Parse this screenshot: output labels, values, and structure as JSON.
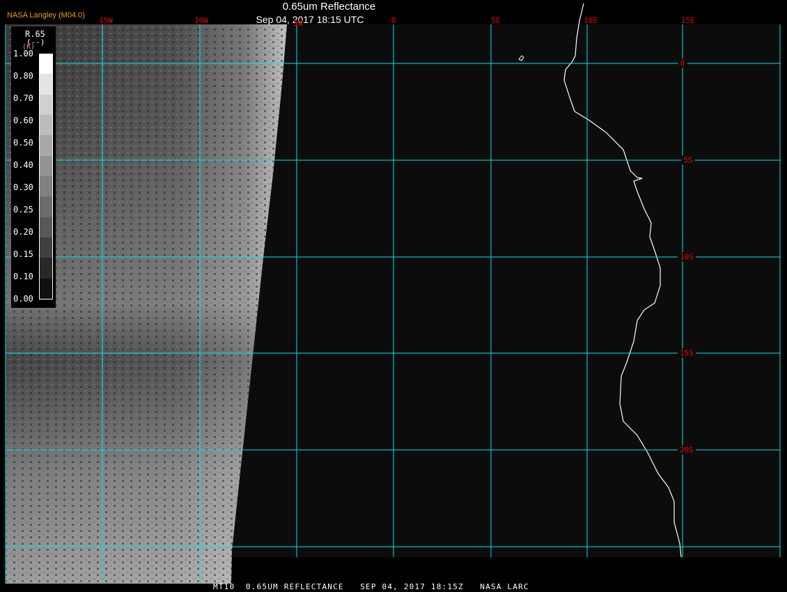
{
  "header": {
    "title": "0.65um Reflectance",
    "subtitle": "Sep 04, 2017 18:15 UTC",
    "brand": "NASA Langley (M04.0)"
  },
  "footer": {
    "text": "MT10  0.65UM REFLECTANCE   SEP 04, 2017 18:15Z   NASA LARC"
  },
  "grid": {
    "lon_labels": [
      "15W",
      "10W",
      "5W",
      "0",
      "5E",
      "10E",
      "15E"
    ],
    "lat_labels": [
      "0",
      "5S",
      "10S",
      "15S",
      "20S"
    ],
    "line_color": "#00e5ee",
    "label_color": "#e00000"
  },
  "legend": {
    "variable": "R.65",
    "units": "(--)",
    "unit_k": "(K)",
    "ticks": [
      "1.00",
      "0.80",
      "0.70",
      "0.60",
      "0.50",
      "0.40",
      "0.30",
      "0.25",
      "0.20",
      "0.15",
      "0.10",
      "0.00"
    ],
    "shades": [
      "#ffffff",
      "#e4e4e4",
      "#d0d0d0",
      "#bcbcbc",
      "#a8a8a8",
      "#949494",
      "#808080",
      "#6c6c6c",
      "#585858",
      "#404040",
      "#282828",
      "#101010"
    ]
  }
}
